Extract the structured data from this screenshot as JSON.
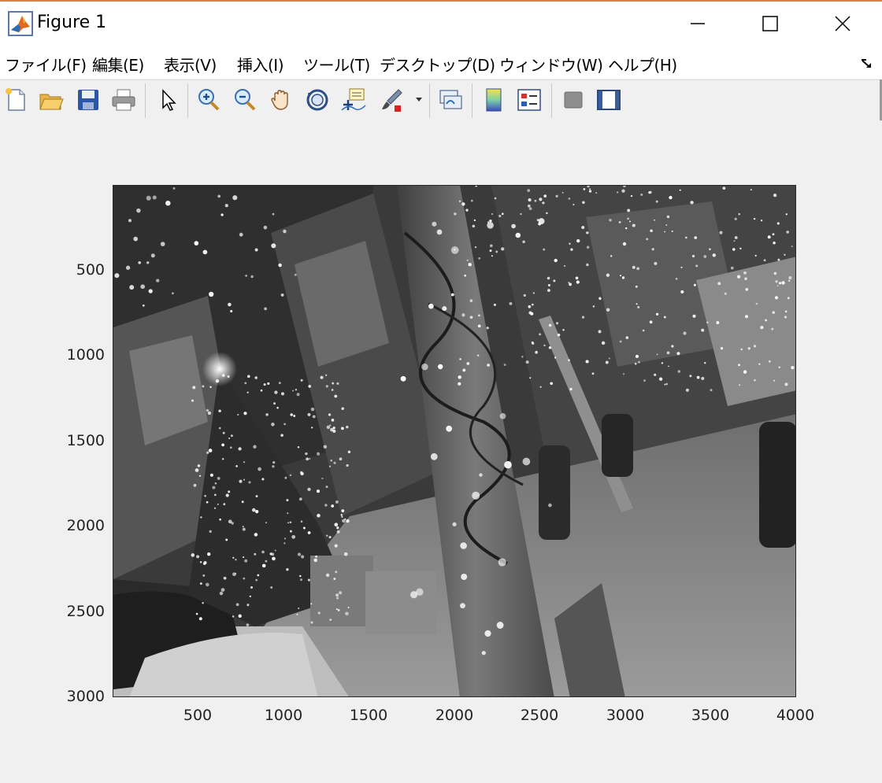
{
  "window": {
    "title": "Figure 1",
    "controls": {
      "minimize": "minimize",
      "maximize": "maximize",
      "close": "close"
    }
  },
  "menu": [
    "ファイル(F)",
    "編集(E)",
    "表示(V)",
    "挿入(I)",
    "ツール(T)",
    "デスクトップ(D)",
    "ウィンドウ(W)",
    "ヘルプ(H)"
  ],
  "toolbar": [
    "new-figure-icon",
    "open-file-icon",
    "save-icon",
    "print-icon",
    "edit-plot-arrow-icon",
    "zoom-in-icon",
    "zoom-out-icon",
    "pan-hand-icon",
    "rotate-3d-icon",
    "data-cursor-icon",
    "brush-icon",
    "link-plot-icon",
    "colorbar-icon",
    "legend-icon",
    "hide-plot-tools-icon",
    "show-plot-tools-icon"
  ],
  "axes": {
    "y_ticks": [
      "500",
      "1000",
      "1500",
      "2000",
      "2500",
      "3000"
    ],
    "x_ticks": [
      "500",
      "1000",
      "1500",
      "2000",
      "2500",
      "3000",
      "3500",
      "4000"
    ],
    "xlim": [
      1,
      4000
    ],
    "ylim": [
      1,
      3000
    ],
    "image_description_hidden": false
  },
  "colors": {
    "title_accent": "#d9834a",
    "background": "#f0f0f0"
  }
}
